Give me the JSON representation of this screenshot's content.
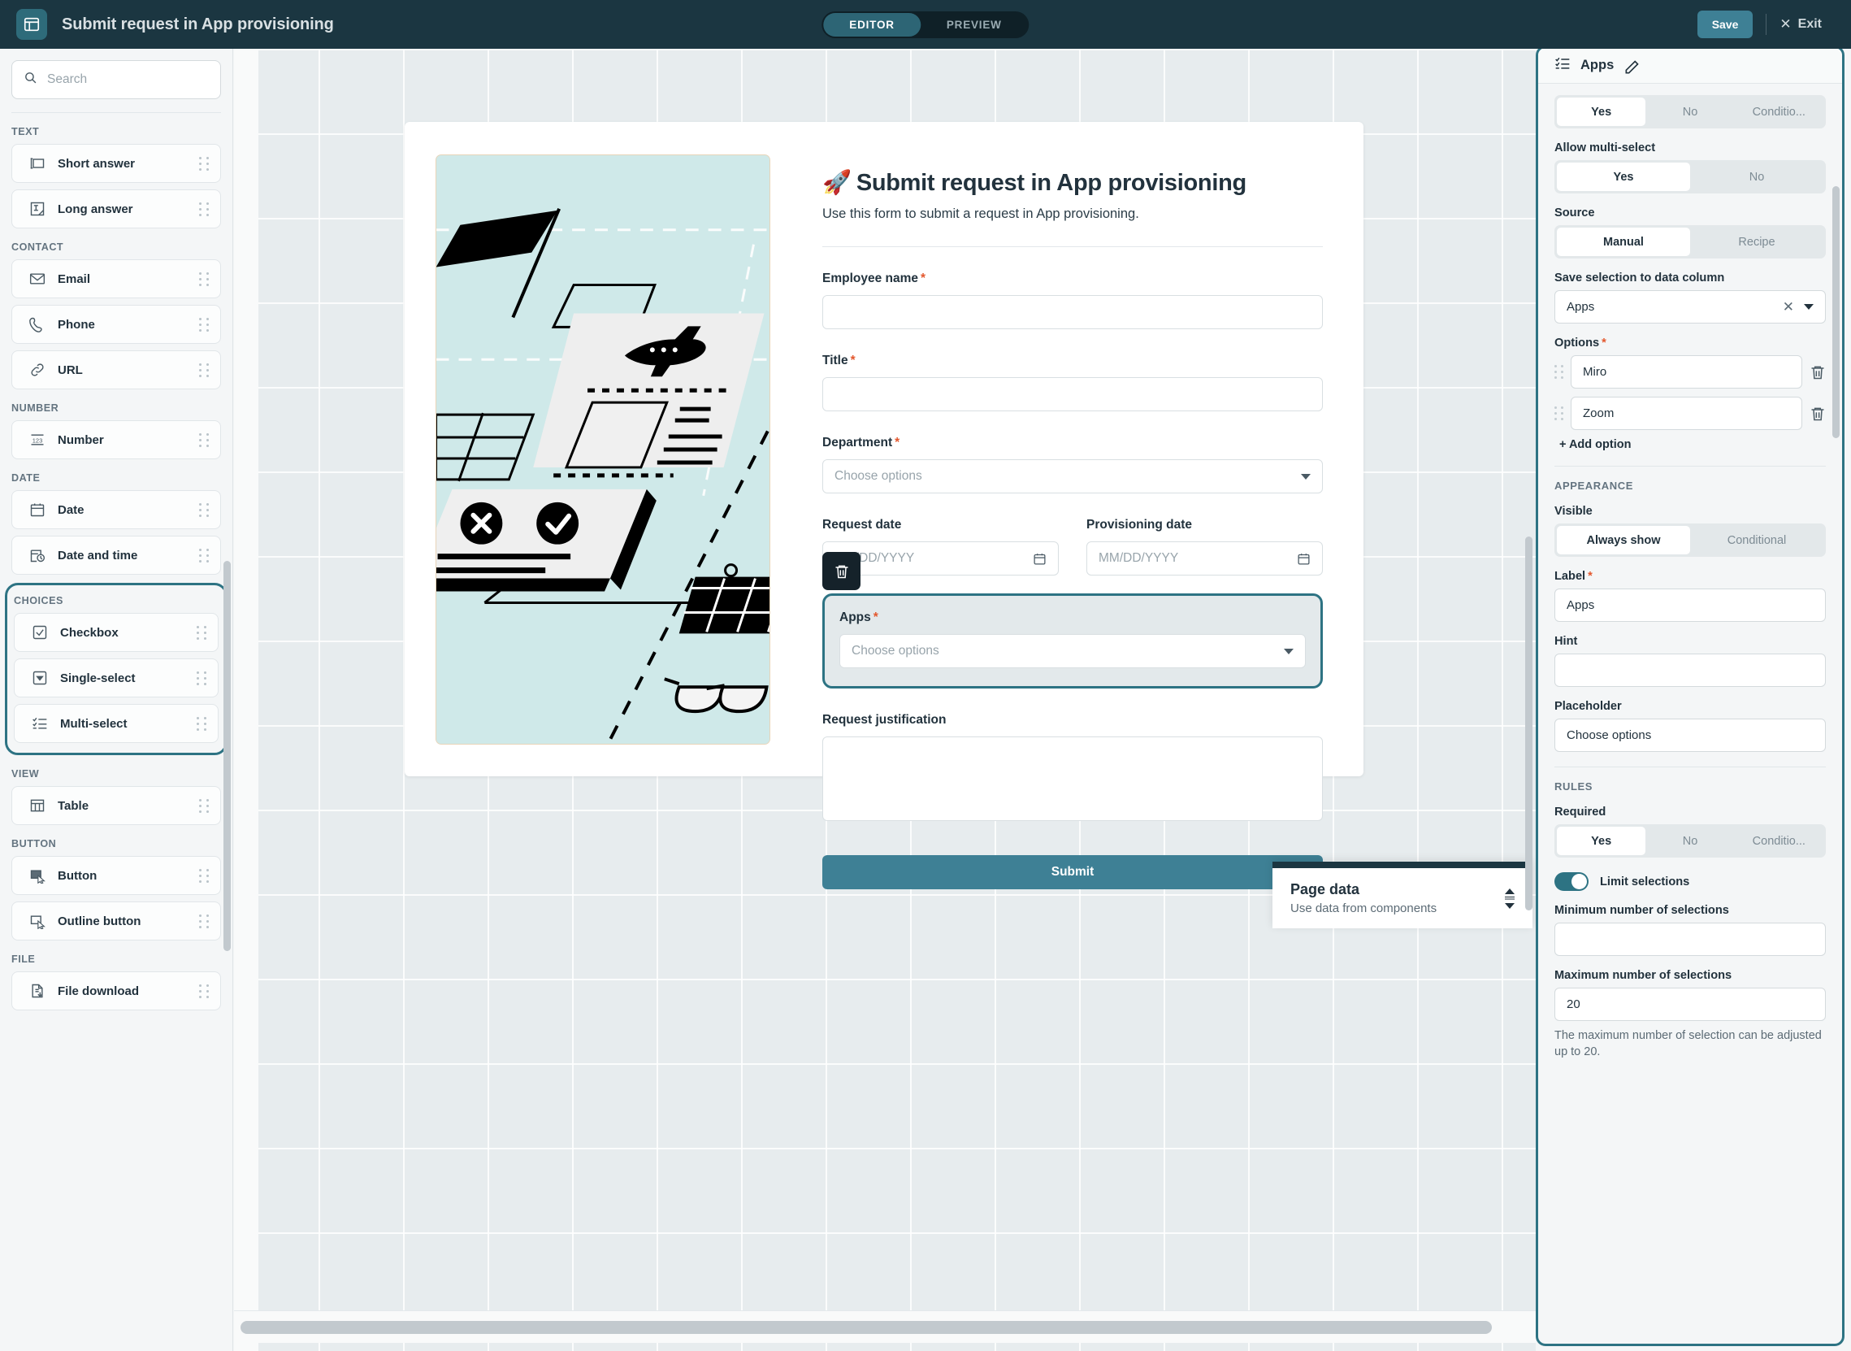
{
  "topbar": {
    "logo_icon": "app-window-icon",
    "title": "Submit request in App provisioning",
    "modes": [
      {
        "label": "EDITOR",
        "active": true
      },
      {
        "label": "PREVIEW",
        "active": false
      }
    ],
    "save_label": "Save",
    "exit_label": "Exit",
    "exit_icon": "close-icon",
    "accent": "#3e8095",
    "bg": "#1b3641"
  },
  "left_panel": {
    "search": {
      "value": "",
      "placeholder": "Search",
      "icon": "search-icon"
    },
    "groups": [
      {
        "title": "TEXT",
        "highlighted": false,
        "items": [
          {
            "label": "Short answer",
            "icon": "short-answer-icon"
          },
          {
            "label": "Long answer",
            "icon": "long-answer-icon"
          }
        ]
      },
      {
        "title": "CONTACT",
        "highlighted": false,
        "items": [
          {
            "label": "Email",
            "icon": "envelope-icon"
          },
          {
            "label": "Phone",
            "icon": "phone-icon"
          },
          {
            "label": "URL",
            "icon": "link-icon"
          }
        ]
      },
      {
        "title": "NUMBER",
        "highlighted": false,
        "items": [
          {
            "label": "Number",
            "icon": "number-123-icon"
          }
        ]
      },
      {
        "title": "DATE",
        "highlighted": false,
        "items": [
          {
            "label": "Date",
            "icon": "calendar-icon"
          },
          {
            "label": "Date and time",
            "icon": "calendar-clock-icon"
          }
        ]
      },
      {
        "title": "CHOICES",
        "highlighted": true,
        "items": [
          {
            "label": "Checkbox",
            "icon": "checkbox-icon"
          },
          {
            "label": "Single-select",
            "icon": "dropdown-icon"
          },
          {
            "label": "Multi-select",
            "icon": "multi-select-icon"
          }
        ]
      },
      {
        "title": "VIEW",
        "highlighted": false,
        "items": [
          {
            "label": "Table",
            "icon": "table-icon"
          }
        ]
      },
      {
        "title": "BUTTON",
        "highlighted": false,
        "items": [
          {
            "label": "Button",
            "icon": "filled-button-icon"
          },
          {
            "label": "Outline button",
            "icon": "outline-button-icon"
          }
        ]
      },
      {
        "title": "FILE",
        "highlighted": false,
        "items": [
          {
            "label": "File download",
            "icon": "file-download-icon"
          }
        ]
      }
    ],
    "highlight_color": "#2d7383"
  },
  "form": {
    "title_emoji": "🚀",
    "title": "Submit request in App provisioning",
    "subtitle": "Use this form to submit a request in App provisioning.",
    "illustration_bg": "#cfe9e9",
    "fields": [
      {
        "label": "Employee name",
        "required": true,
        "type": "text",
        "value": "",
        "placeholder": ""
      },
      {
        "label": "Title",
        "required": true,
        "type": "text",
        "value": "",
        "placeholder": ""
      },
      {
        "label": "Department",
        "required": true,
        "type": "select",
        "value": "",
        "placeholder": "Choose options"
      },
      {
        "label": "Request date",
        "required": false,
        "type": "date",
        "value": "",
        "placeholder": "MM/DD/YYYY"
      },
      {
        "label": "Provisioning date",
        "required": false,
        "type": "date",
        "value": "",
        "placeholder": "MM/DD/YYYY"
      },
      {
        "label": "Apps",
        "required": true,
        "type": "select",
        "value": "",
        "placeholder": "Choose options",
        "selected": true
      },
      {
        "label": "Request justification",
        "required": false,
        "type": "textarea",
        "value": "",
        "placeholder": ""
      }
    ],
    "delete_icon": "trash-icon",
    "submit_label": "Submit"
  },
  "page_data_widget": {
    "title": "Page data",
    "subtitle": "Use data from components",
    "resize_icon": "resize-handle-icon"
  },
  "right_panel": {
    "header": {
      "icon": "multi-select-icon",
      "title": "Apps",
      "edit_icon": "pencil-icon"
    },
    "enabled_segmented": {
      "options": [
        "Yes",
        "No",
        "Conditio..."
      ],
      "selected": "Yes"
    },
    "allow_multi_select": {
      "label": "Allow multi-select",
      "options": [
        "Yes",
        "No"
      ],
      "selected": "Yes"
    },
    "source": {
      "label": "Source",
      "options": [
        "Manual",
        "Recipe"
      ],
      "selected": "Manual"
    },
    "data_column": {
      "label": "Save selection to data column",
      "value": "Apps",
      "clear_icon": "close-icon",
      "caret_icon": "chevron-down-icon"
    },
    "options_field": {
      "label": "Options",
      "required": true,
      "items": [
        {
          "value": "Miro",
          "delete_icon": "trash-icon",
          "grip_icon": "drag-grip-icon"
        },
        {
          "value": "Zoom",
          "delete_icon": "trash-icon",
          "grip_icon": "drag-grip-icon"
        }
      ],
      "add_label": "+ Add option"
    },
    "appearance": {
      "section": "APPEARANCE",
      "visible": {
        "label": "Visible",
        "options": [
          "Always show",
          "Conditional"
        ],
        "selected": "Always show"
      },
      "label_field": {
        "label": "Label",
        "required": true,
        "value": "Apps"
      },
      "hint_field": {
        "label": "Hint",
        "value": "",
        "placeholder": ""
      },
      "placeholder_field": {
        "label": "Placeholder",
        "value": "Choose options"
      }
    },
    "rules": {
      "section": "RULES",
      "required": {
        "label": "Required",
        "options": [
          "Yes",
          "No",
          "Conditio..."
        ],
        "selected": "Yes"
      },
      "limit_selections": {
        "label": "Limit selections",
        "on": true
      },
      "minimum": {
        "label": "Minimum number of selections",
        "value": ""
      },
      "maximum": {
        "label": "Maximum number of selections",
        "value": "20"
      },
      "help_text": "The maximum number of selection can be adjusted up to 20."
    },
    "border_color": "#2d7383"
  }
}
